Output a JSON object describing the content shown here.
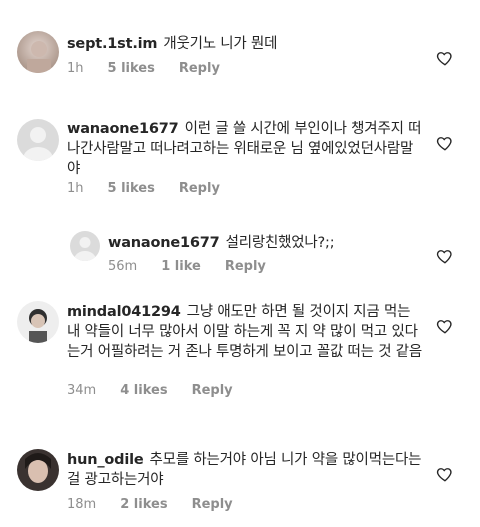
{
  "comments": [
    {
      "username": "sept.1st.im",
      "text": "개웃기노 니가 뭔데",
      "time": "1h",
      "likes": "5 likes",
      "reply": "Reply"
    },
    {
      "username": "wanaone1677",
      "text": "이런 글 쓸 시간에 부인이나 챙겨주지 떠나간사람말고 떠나려고하는 위태로운 님 옆에있었던사람말야",
      "time": "1h",
      "likes": "5 likes",
      "reply": "Reply"
    },
    {
      "username": "wanaone1677",
      "text": "설리랑친했었나?;;",
      "time": "56m",
      "likes": "1 like",
      "reply": "Reply"
    },
    {
      "username": "mindal041294",
      "text": "그냥 애도만 하면 될 것이지 지금 먹는 내 약들이 너무 많아서 이말 하는게 꼭 지 약 많이 먹고 있다는거 어필하려는 거 존나 투명하게 보이고 꼴값 떠는 것 같음",
      "time": "34m",
      "likes": "4 likes",
      "reply": "Reply"
    },
    {
      "username": "hun_odile",
      "text": "추모를 하는거야 아님 니가 약을 많이먹는다는걸 광고하는거야",
      "time": "18m",
      "likes": "2 likes",
      "reply": "Reply"
    }
  ],
  "colors": {
    "text": "#262626",
    "meta": "#8e8e8e"
  },
  "icons": {
    "like": "heart-outline-icon"
  }
}
